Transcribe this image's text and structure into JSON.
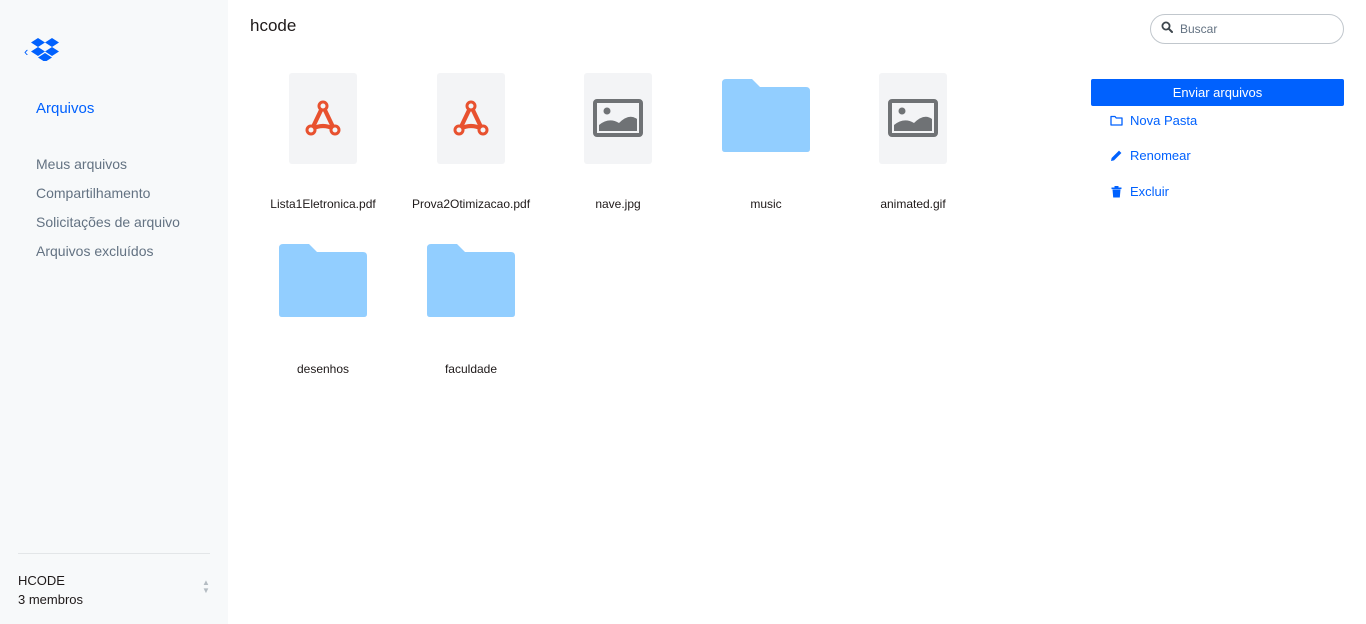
{
  "sidebar": {
    "logo": "dropbox-logo",
    "back_icon": "chevron-left-icon",
    "title": "Arquivos",
    "items": [
      {
        "label": "Meus arquivos"
      },
      {
        "label": "Compartilhamento"
      },
      {
        "label": "Solicitações de arquivo"
      },
      {
        "label": "Arquivos excluídos"
      }
    ],
    "team": {
      "name": "HCODE",
      "members": "3 membros"
    }
  },
  "header": {
    "title": "hcode",
    "search": {
      "placeholder": "Buscar",
      "value": ""
    }
  },
  "files": [
    {
      "name": "Lista1Eletronica.pdf",
      "kind": "pdf",
      "icon": "pdf-icon"
    },
    {
      "name": "Prova2Otimizacao.pdf",
      "kind": "pdf",
      "icon": "pdf-icon"
    },
    {
      "name": "nave.jpg",
      "kind": "image",
      "icon": "image-icon"
    },
    {
      "name": "music",
      "kind": "folder",
      "icon": "folder-icon"
    },
    {
      "name": "animated.gif",
      "kind": "image",
      "icon": "image-icon"
    },
    {
      "name": "desenhos",
      "kind": "folder",
      "icon": "folder-icon"
    },
    {
      "name": "faculdade",
      "kind": "folder",
      "icon": "folder-icon"
    }
  ],
  "actions": {
    "upload_label": "Enviar arquivos",
    "new_folder_label": "Nova Pasta",
    "rename_label": "Renomear",
    "delete_label": "Excluir"
  },
  "colors": {
    "accent": "#0061fe",
    "pdf": "#e8512f",
    "folder": "#92ceff",
    "sidebar_bg": "#f7f9fa"
  }
}
